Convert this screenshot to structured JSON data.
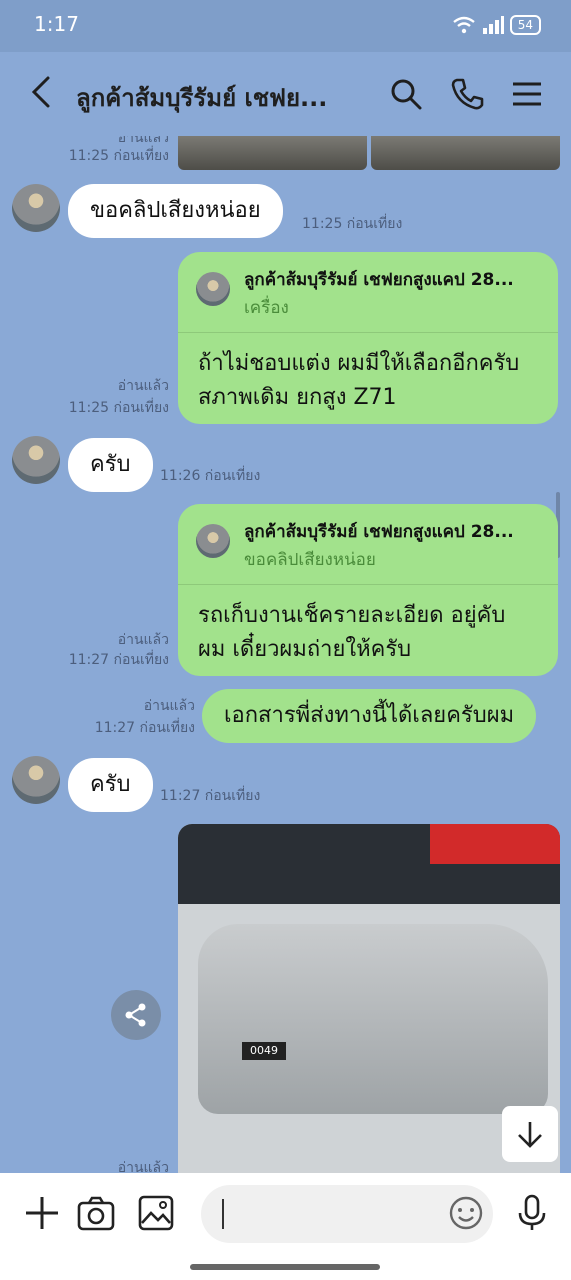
{
  "status": {
    "time": "1:17",
    "battery": "54"
  },
  "header": {
    "title": "ลูกค้าส้มบุรีรัมย์ เชฟย..."
  },
  "messages": {
    "m0": {
      "read": "อ่านแล้ว",
      "time": "11:25 ก่อนเที่ยง"
    },
    "m1": {
      "text": "ขอคลิปเสียงหน่อย",
      "time": "11:25 ก่อนเที่ยง"
    },
    "m2": {
      "quote_name": "ลูกค้าส้มบุรีรัมย์ เชฟยกสูงแคป 28...",
      "quote_text": "เครื่อง",
      "line1": "ถ้าไม่ชอบแต่ง ผมมีให้เลือกอีกครับ",
      "line2": "สภาพเดิม ยกสูง Z71",
      "read": "อ่านแล้ว",
      "time": "11:25 ก่อนเที่ยง"
    },
    "m3": {
      "text": "ครับ",
      "time": "11:26 ก่อนเที่ยง"
    },
    "m4": {
      "quote_name": "ลูกค้าส้มบุรีรัมย์ เชฟยกสูงแคป 28...",
      "quote_text": "ขอคลิปเสียงหน่อย",
      "line1": "รถเก็บงานเช็ครายละเอียด อยู่คับ",
      "line2": "ผม เดี๋ยวผมถ่ายให้ครับ",
      "read": "อ่านแล้ว",
      "time": "11:27 ก่อนเที่ยง"
    },
    "m5": {
      "text": "เอกสารพี่ส่งทางนี้ได้เลยครับผม",
      "read": "อ่านแล้ว",
      "time": "11:27 ก่อนเที่ยง"
    },
    "m6": {
      "text": "ครับ",
      "time": "11:27 ก่อนเที่ยง"
    },
    "m7": {
      "read": "อ่านแล้ว",
      "plate": "0049"
    }
  },
  "colors": {
    "background": "#8aa9d6",
    "bubble_out": "#a2e28c",
    "bubble_in": "#ffffff"
  },
  "icons": [
    "back-icon",
    "search-icon",
    "phone-icon",
    "menu-icon",
    "share-icon",
    "arrow-down-icon",
    "plus-icon",
    "camera-icon",
    "image-icon",
    "emoji-icon",
    "mic-icon"
  ]
}
